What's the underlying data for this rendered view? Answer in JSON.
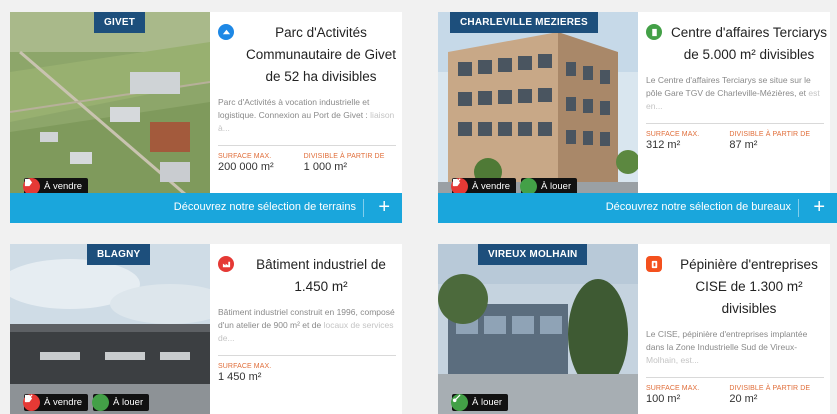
{
  "cards": [
    {
      "tag": "GIVET",
      "title": "Parc d'Activités Communautaire de Givet de 52 ha divisibles",
      "description": "Parc d'Activités à vocation industrielle et logistique. Connexion au Port de Givet :",
      "description_fade": "liaison à...",
      "icon": "parc-icon",
      "icon_color": "#1e88e5",
      "badges": [
        "À vendre"
      ],
      "surface_label": "SURFACE MAX.",
      "surface_value": "200 000 m²",
      "divisible_label": "DIVISIBLE À PARTIR DE",
      "divisible_value": "1 000 m²"
    },
    {
      "tag": "CHARLEVILLE MEZIERES",
      "title": "Centre d'affaires Terciarys de 5.000 m² divisibles",
      "description": "Le Centre d'affaires Terciarys se situe sur le pôle Gare TGV de Charleville-Mézières, et",
      "description_fade": "est en...",
      "icon": "office-icon",
      "icon_color": "#43a047",
      "badges": [
        "À vendre",
        "À louer"
      ],
      "surface_label": "SURFACE MAX.",
      "surface_value": "312 m²",
      "divisible_label": "DIVISIBLE À PARTIR DE",
      "divisible_value": "87 m²"
    },
    {
      "tag": "BLAGNY",
      "title": "Bâtiment industriel de 1.450 m²",
      "description": "Bâtiment industriel construit en 1996, composé d'un atelier de 900 m² et de",
      "description_fade": "locaux de services de...",
      "icon": "industry-icon",
      "icon_color": "#e53935",
      "badges": [
        "À vendre",
        "À louer"
      ],
      "surface_label": "SURFACE MAX.",
      "surface_value": "1 450 m²"
    },
    {
      "tag": "VIREUX MOLHAIN",
      "title": "Pépinière d'entreprises CISE de 1.300 m² divisibles",
      "description": "Le CISE, pépinière d'entreprises implantée dans la Zone Industrielle Sud de Vireux-",
      "description_fade": "Molhain, est...",
      "icon": "incubator-icon",
      "icon_color": "#f4511e",
      "badges": [
        "À louer"
      ],
      "surface_label": "SURFACE MAX.",
      "surface_value": "100 m²",
      "divisible_label": "DIVISIBLE À PARTIR DE",
      "divisible_value": "20 m²"
    }
  ],
  "cta_terrains": "Découvrez notre sélection de terrains",
  "cta_bureaux": "Découvrez notre sélection de bureaux",
  "colors": {
    "tag_bg": "#1d4f7c",
    "cta_bg": "#1aa6dc",
    "label_orange": "#e06e3a"
  }
}
